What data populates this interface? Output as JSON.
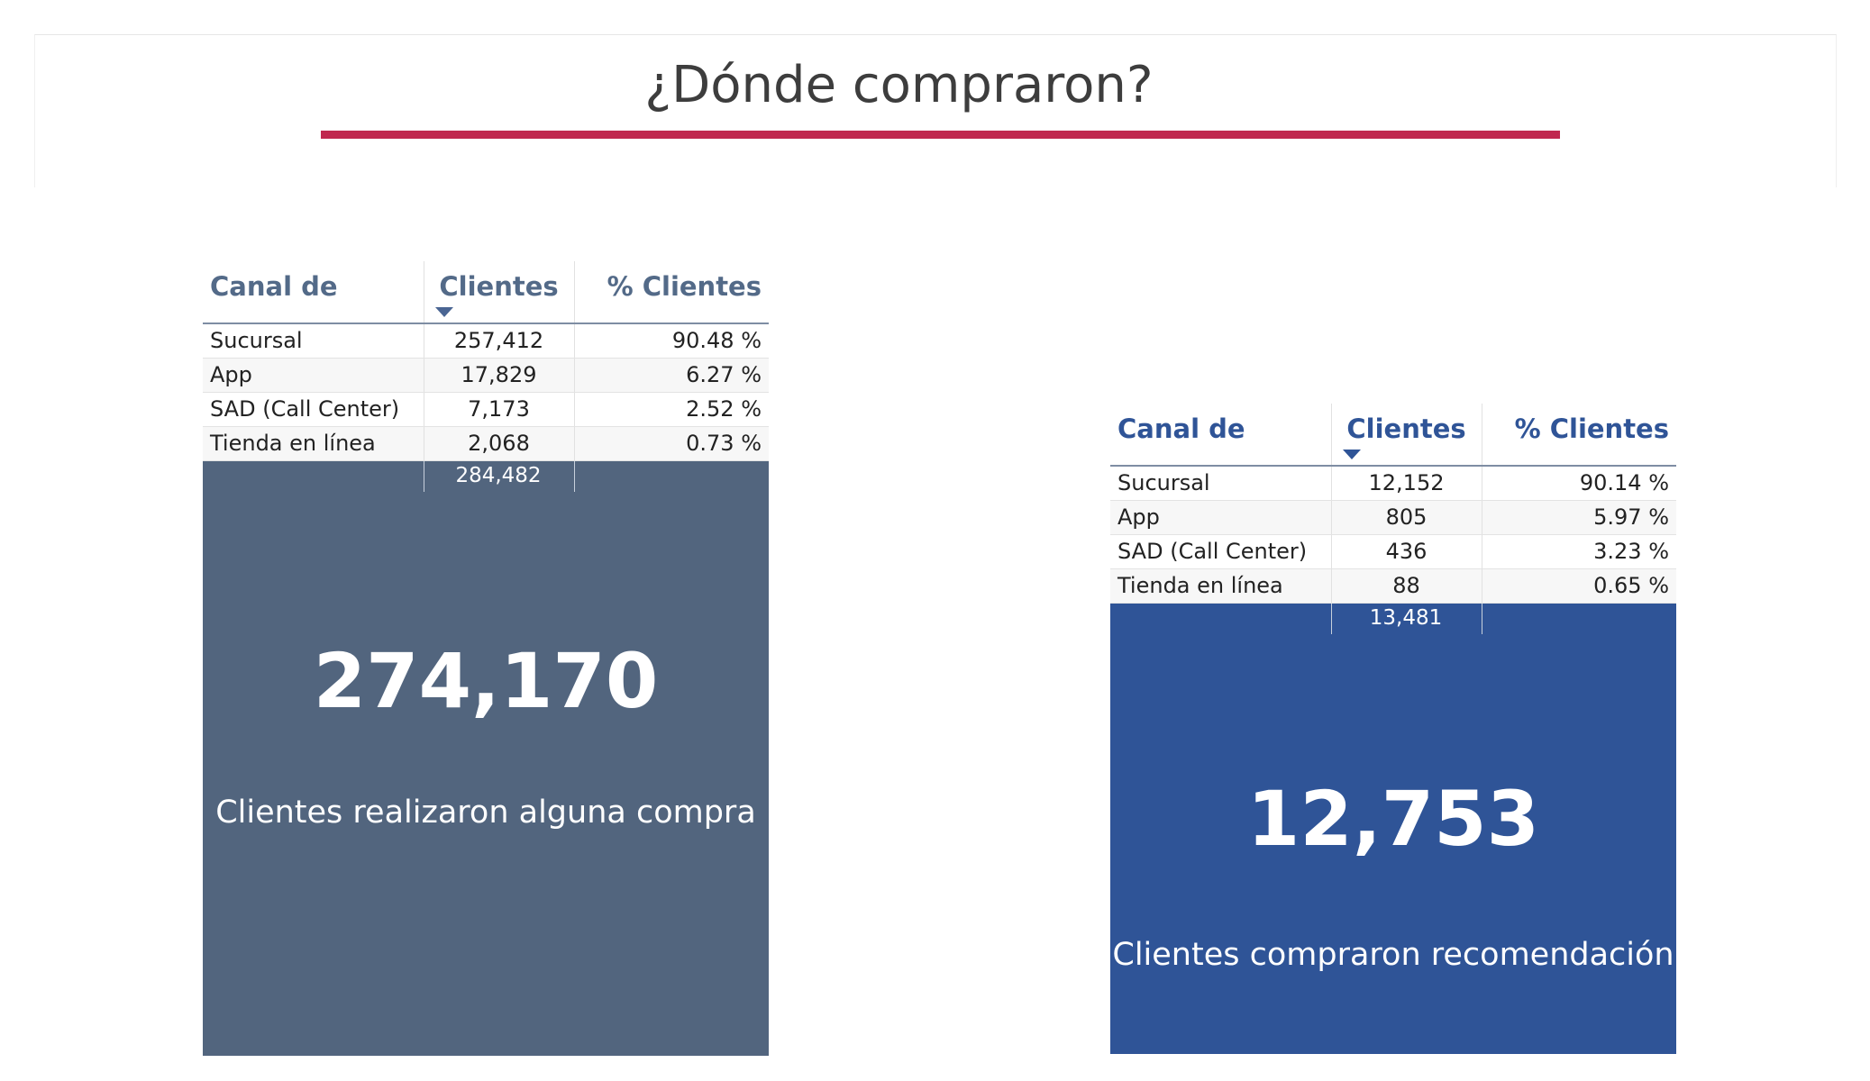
{
  "title": "¿Dónde compraron?",
  "colors": {
    "accent_rule": "#c0284f",
    "left_panel": "#52657e",
    "right_panel": "#2f5497"
  },
  "tables": [
    {
      "headers": {
        "canal": "Canal de venta",
        "clientes": "Clientes",
        "pct": "% Clientes"
      },
      "rows": [
        {
          "canal": "Sucursal",
          "clientes": "257,412",
          "pct": "90.48 %"
        },
        {
          "canal": "App",
          "clientes": "17,829",
          "pct": "6.27 %"
        },
        {
          "canal": "SAD (Call Center)",
          "clientes": "7,173",
          "pct": "2.52 %"
        },
        {
          "canal": "Tienda en línea",
          "clientes": "2,068",
          "pct": "0.73 %"
        }
      ],
      "total": "284,482",
      "kpi_value": "274,170",
      "kpi_caption": "Clientes realizaron alguna compra"
    },
    {
      "headers": {
        "canal": "Canal de venta",
        "clientes": "Clientes",
        "pct": "% Clientes"
      },
      "rows": [
        {
          "canal": "Sucursal",
          "clientes": "12,152",
          "pct": "90.14 %"
        },
        {
          "canal": "App",
          "clientes": "805",
          "pct": "5.97 %"
        },
        {
          "canal": "SAD (Call Center)",
          "clientes": "436",
          "pct": "3.23 %"
        },
        {
          "canal": "Tienda en línea",
          "clientes": "88",
          "pct": "0.65 %"
        }
      ],
      "total": "13,481",
      "kpi_value": "12,753",
      "kpi_caption": "Clientes compraron recomendación"
    }
  ]
}
